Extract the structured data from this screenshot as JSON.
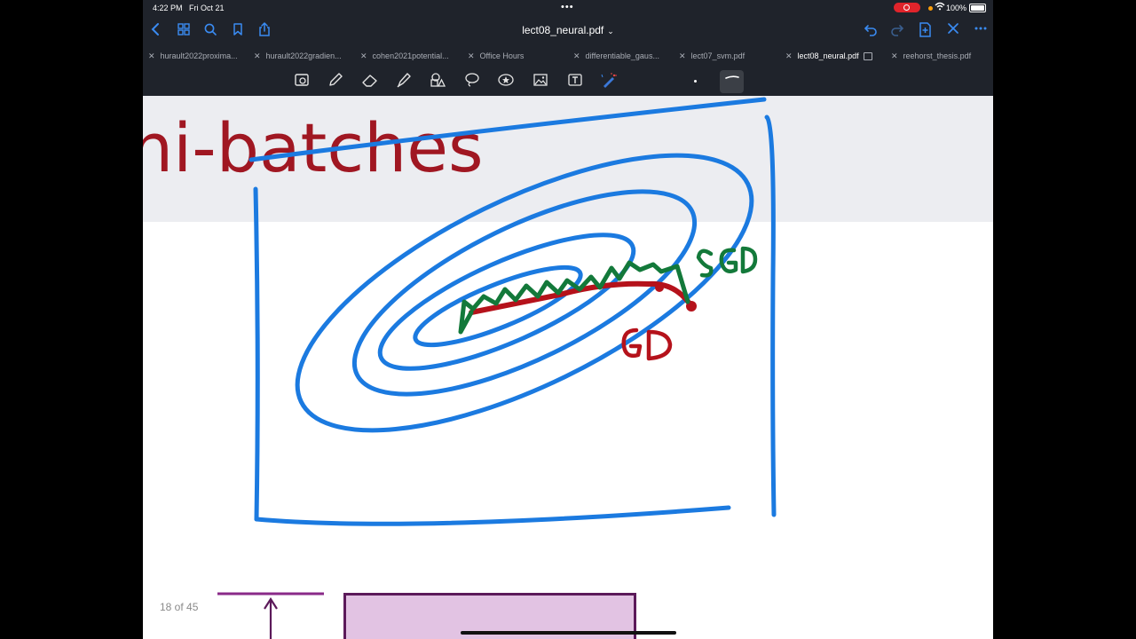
{
  "status": {
    "time": "4:22 PM",
    "date": "Fri Oct 21",
    "battery": "100%"
  },
  "nav": {
    "title": "lect08_neural.pdf",
    "chevron": "⌄",
    "icons": [
      "back-icon",
      "grid-icon",
      "search-icon",
      "bookmark-icon",
      "share-icon",
      "undo-icon",
      "redo-icon",
      "add-page-icon",
      "close-icon",
      "more-icon"
    ]
  },
  "tabs": [
    {
      "label": "hurault2022proxima...",
      "active": false
    },
    {
      "label": "hurault2022gradien...",
      "active": false
    },
    {
      "label": "cohen2021potential...",
      "active": false
    },
    {
      "label": "Office Hours",
      "active": false
    },
    {
      "label": "differentiable_gaus...",
      "active": false
    },
    {
      "label": "lect07_svm.pdf",
      "active": false
    },
    {
      "label": "lect08_neural.pdf",
      "active": true
    },
    {
      "label": "reehorst_thesis.pdf",
      "active": false
    }
  ],
  "toolbar": {
    "tools": [
      "lasso-image-icon",
      "pen-icon",
      "eraser-icon",
      "highlighter-icon",
      "shapes-icon",
      "lasso-icon",
      "sticker-icon",
      "image-icon",
      "text-icon",
      "laser-pointer-icon"
    ],
    "stroke_sizes": [
      "small",
      "medium"
    ],
    "selected_stroke": "medium"
  },
  "slide": {
    "title": "ni-batches",
    "page_indicator": "18 of 45"
  },
  "annotations": {
    "sgd_label": "SGD",
    "gd_label": "GD",
    "colors": {
      "blue": "#1b7ae0",
      "green": "#13793a",
      "red": "#b5121b",
      "title": "#a01722"
    }
  }
}
